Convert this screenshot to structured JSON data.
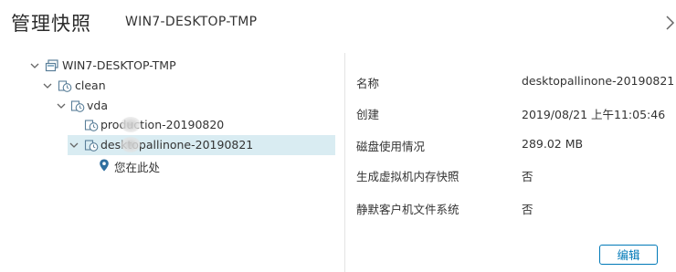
{
  "header": {
    "title": "管理快照",
    "vm_name": "WIN7-DESKTOP-TMP"
  },
  "tree": {
    "root": "WIN7-DESKTOP-TMP",
    "clean": "clean",
    "vda": "vda",
    "snapshot1": "production-20190820",
    "snapshot2": "desktopallinone-20190821",
    "you_are_here": "您在此处"
  },
  "details": {
    "name_label": "名称",
    "name_value": "desktopallinone-20190821",
    "created_label": "创建",
    "created_value": "2019/08/21 上午11:05:46",
    "disk_label": "磁盘使用情况",
    "disk_value": "289.02 MB",
    "memory_label": "生成虚拟机内存快照",
    "memory_value": "否",
    "quiesce_label": "静默客户机文件系统",
    "quiesce_value": "否"
  },
  "actions": {
    "edit_label": "编辑"
  },
  "colors": {
    "accent": "#0079b8",
    "selected_row": "#d9ecf2"
  }
}
